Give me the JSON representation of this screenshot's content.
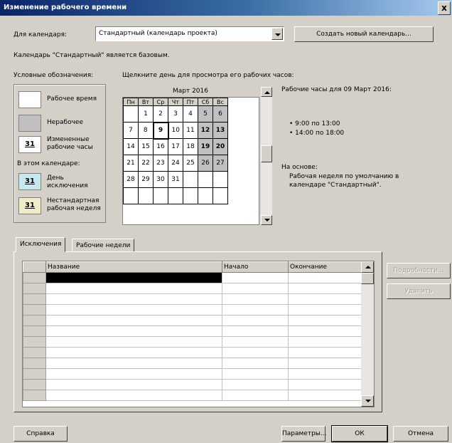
{
  "window": {
    "title": "Изменение рабочего времени",
    "close_label": "x"
  },
  "calendar_select": {
    "label": "Для календаря:",
    "value": "Стандартный (календарь проекта)",
    "create_button": "Создать новый календарь..."
  },
  "base_note": "Календарь \"Стандартный\" является базовым.",
  "legend": {
    "heading": "Условные обозначения:",
    "items": [
      {
        "label_lines": [
          "Рабочее время"
        ],
        "swatch": ""
      },
      {
        "label_lines": [
          "Нерабочее"
        ],
        "swatch": ""
      },
      {
        "label_lines": [
          "Измененные",
          "рабочие часы"
        ],
        "swatch": "31"
      }
    ],
    "in_calendar_heading": "В этом календаре:",
    "calendar_items": [
      {
        "label_lines": [
          "День",
          "исключения"
        ],
        "swatch": "31"
      },
      {
        "label_lines": [
          "Нестандартная",
          "рабочая неделя"
        ],
        "swatch": "31"
      }
    ]
  },
  "calendar": {
    "instruction": "Щелкните день для просмотра его рабочих часов:",
    "month": "Март 2016",
    "weekdays": [
      "Пн",
      "Вт",
      "Ср",
      "Чт",
      "Пт",
      "Сб",
      "Вс"
    ],
    "weeks": [
      [
        "",
        "1",
        "2",
        "3",
        "4",
        "5",
        "6"
      ],
      [
        "7",
        "8",
        "9",
        "10",
        "11",
        "12",
        "13"
      ],
      [
        "14",
        "15",
        "16",
        "17",
        "18",
        "19",
        "20"
      ],
      [
        "21",
        "22",
        "23",
        "24",
        "25",
        "26",
        "27"
      ],
      [
        "28",
        "29",
        "30",
        "31",
        "",
        "",
        ""
      ]
    ],
    "selected_day": "9"
  },
  "working_hours": {
    "title": "Рабочие часы для 09 Март 2016:",
    "times": [
      "• 9:00 по 13:00",
      "• 14:00 по 18:00"
    ],
    "basis_label": "На основе:",
    "basis_text_lines": [
      "Рабочая неделя по умолчанию в",
      "календаре \"Стандартный\"."
    ]
  },
  "tabs": [
    {
      "label": "Исключения",
      "active": true
    },
    {
      "label": "Рабочие недели",
      "active": false
    }
  ],
  "exceptions_table": {
    "columns": [
      "Название",
      "Начало",
      "Окончание"
    ]
  },
  "side_buttons": {
    "details": "Подробности...",
    "delete": "Удалить"
  },
  "footer": {
    "help": "Справка",
    "options": "Параметры...",
    "ok": "ОК",
    "cancel": "Отмена"
  }
}
